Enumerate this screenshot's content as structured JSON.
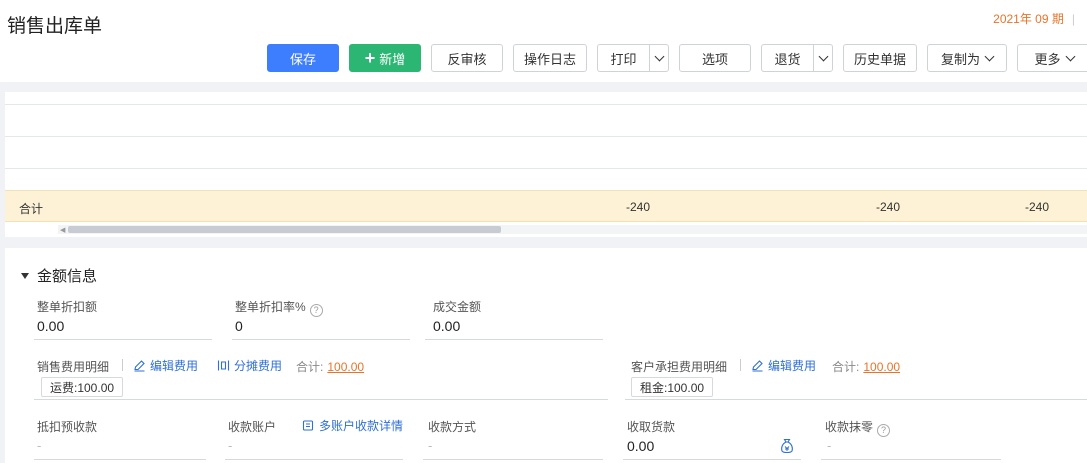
{
  "header": {
    "title": "销售出库单",
    "period": "2021年 09 期",
    "period_sep": "|"
  },
  "toolbar": {
    "save": "保存",
    "new": "新增",
    "unaudit": "反审核",
    "oplog": "操作日志",
    "print": "打印",
    "options": "选项",
    "return": "退货",
    "history": "历史单据",
    "copy_as": "复制为",
    "more": "更多"
  },
  "grid": {
    "total_label": "合计",
    "totals": [
      "-240",
      "-240",
      "-240"
    ]
  },
  "amount_section": {
    "title": "金额信息",
    "discount_label": "整单折扣额",
    "discount_value": "0.00",
    "discount_rate_label": "整单折扣率%",
    "discount_rate_value": "0",
    "deal_amount_label": "成交金额",
    "deal_amount_value": "0.00",
    "sales_fee_label": "销售费用明细",
    "edit_fee": "编辑费用",
    "split_fee": "分摊费用",
    "sum_label": "合计:",
    "sales_fee_total": "100.00",
    "sales_fee_tag": "运费:100.00",
    "customer_fee_label": "客户承担费用明细",
    "customer_fee_total": "100.00",
    "customer_fee_tag": "租金:100.00",
    "prepay_label": "抵扣预收款",
    "prepay_value": "-",
    "account_label": "收款账户",
    "account_value": "-",
    "multi_account": "多账户收款详情",
    "method_label": "收款方式",
    "method_value": "-",
    "receive_label": "收取货款",
    "receive_value": "0.00",
    "rounding_label": "收款抹零",
    "rounding_value": "-"
  },
  "colors": {
    "primary": "#3d7eff",
    "green": "#2bb673",
    "accent": "#e8742a",
    "total_row": "#fdf2d6"
  }
}
